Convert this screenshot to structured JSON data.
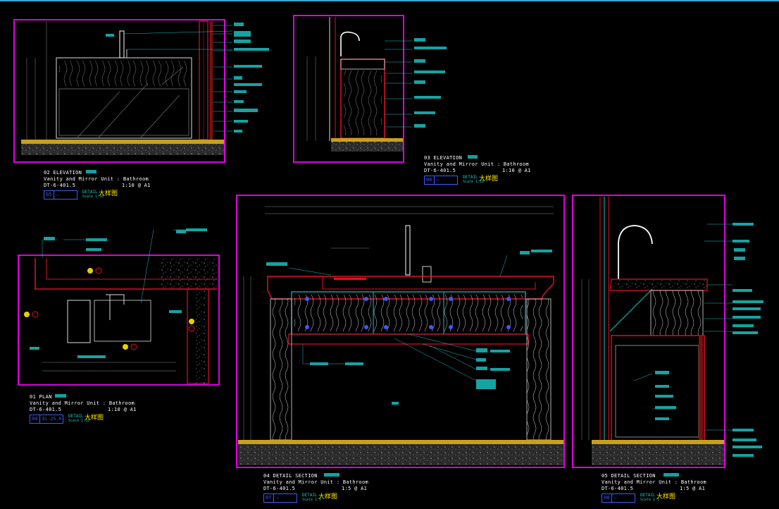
{
  "colors": {
    "background": "#000000",
    "frame": "#e000e0",
    "wall": "#e0102a",
    "dim": "#8a8a8a",
    "leader": "#20c0c0",
    "tag": "#15a3a3",
    "title_text": "#ffffff",
    "detail_text": "#21c5c5",
    "chinese_text": "#ffe800",
    "index_box": "#3a5bff"
  },
  "views": [
    {
      "id": "02",
      "title": "02 ELEVATION",
      "subtitle": "Vanity and Mirror Unit : Bathroom",
      "code": "DT-6-401.5",
      "scale": "1:10 @ A1",
      "index": "05",
      "ref": "—",
      "detail": "DETAIL",
      "detail_sub": "Scale 1:10",
      "cn": "大样图"
    },
    {
      "id": "03",
      "title": "03 ELEVATION",
      "subtitle": "Vanity and Mirror Unit : Bathroom",
      "code": "DT-6-401.5",
      "scale": "1:10 @ A1",
      "index": "06",
      "ref": "—",
      "detail": "DETAIL",
      "detail_sub": "Scale 1:10",
      "cn": "大样图"
    },
    {
      "id": "01",
      "title": "01 PLAN",
      "subtitle": "Vanity and Mirror Unit : Bathroom",
      "code": "DT-6-401.5",
      "scale": "1:10 @ A1",
      "index": "04",
      "ref": "EL-25.0",
      "detail": "DETAIL",
      "detail_sub": "Scale 1:10",
      "cn": "大样图"
    },
    {
      "id": "04",
      "title": "04 DETAIL SECTION",
      "subtitle": "Vanity and Mirror Unit : Bathroom",
      "code": "DT-6-401.5",
      "scale": "1:5 @ A1",
      "index": "07",
      "ref": "—",
      "detail": "DETAIL",
      "detail_sub": "Scale 1:5",
      "cn": "大样图"
    },
    {
      "id": "05",
      "title": "05 DETAIL SECTION",
      "subtitle": "Vanity and Mirror Unit : Bathroom",
      "code": "DT-6-401.5",
      "scale": "1:5 @ A1",
      "index": "08",
      "ref": "—",
      "detail": "DETAIL",
      "detail_sub": "Scale 1:5",
      "cn": "大样图"
    }
  ]
}
